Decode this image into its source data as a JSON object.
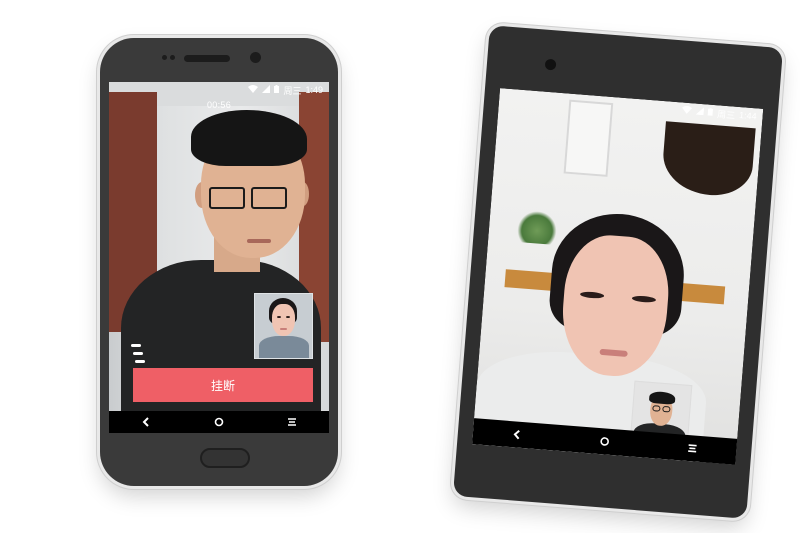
{
  "phone1": {
    "status": {
      "time": "1:49",
      "day": "周三"
    },
    "call": {
      "duration": "00:56",
      "hangup_label": "挂断"
    },
    "nav": {
      "back": "‹",
      "home": "○",
      "recents": "≡"
    }
  },
  "phone2": {
    "status": {
      "time": "1:44",
      "day": "周三"
    },
    "nav": {
      "back": "‹",
      "home": "○",
      "recents": "≡"
    }
  },
  "colors": {
    "hangup": "#ef5f66",
    "phone_body": "#3a3a3a"
  },
  "icons": [
    "wifi-icon",
    "signal-icon",
    "battery-icon",
    "back-icon",
    "home-icon",
    "recents-icon"
  ]
}
